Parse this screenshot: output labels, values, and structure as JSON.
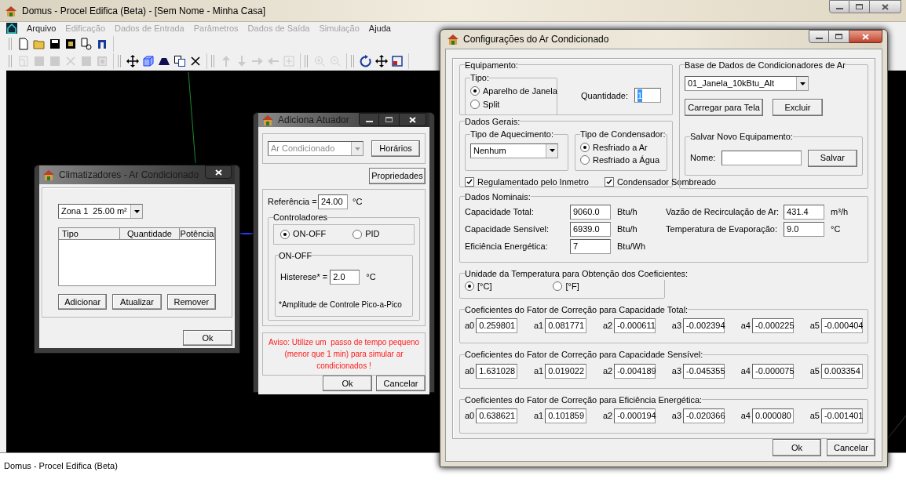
{
  "main_window": {
    "title": "Domus - Procel Edifica (Beta) - [Sem Nome - Minha Casa]",
    "menu": [
      {
        "label": "Arquivo",
        "disabled": false
      },
      {
        "label": "Edificação",
        "disabled": true
      },
      {
        "label": "Dados de Entrada",
        "disabled": true
      },
      {
        "label": "Parâmetros",
        "disabled": true
      },
      {
        "label": "Dados de Saída",
        "disabled": true
      },
      {
        "label": "Simulação",
        "disabled": true
      },
      {
        "label": "Ajuda",
        "disabled": false
      }
    ],
    "toolbars": [
      [
        [
          {
            "kind": "new",
            "disabled": false
          },
          {
            "kind": "open",
            "disabled": false
          },
          {
            "kind": "save",
            "disabled": false
          },
          {
            "kind": "chip",
            "disabled": false
          },
          {
            "kind": "script",
            "disabled": false
          },
          {
            "kind": "door",
            "disabled": false
          }
        ]
      ],
      [
        [
          {
            "kind": "page",
            "disabled": true
          },
          {
            "kind": "square",
            "disabled": true
          },
          {
            "kind": "square",
            "disabled": true
          },
          {
            "kind": "cross",
            "disabled": true
          },
          {
            "kind": "square",
            "disabled": true
          },
          {
            "kind": "frame",
            "disabled": true
          }
        ],
        [
          {
            "kind": "move",
            "disabled": false
          },
          {
            "kind": "cube",
            "disabled": false
          },
          {
            "kind": "shape",
            "disabled": false
          },
          {
            "kind": "copy",
            "disabled": false
          },
          {
            "kind": "cross",
            "disabled": false
          }
        ],
        [
          {
            "kind": "up",
            "disabled": true
          },
          {
            "kind": "down",
            "disabled": true
          },
          {
            "kind": "right",
            "disabled": true
          },
          {
            "kind": "left",
            "disabled": true
          },
          {
            "kind": "plus",
            "disabled": true
          }
        ],
        [
          {
            "kind": "zoomin",
            "disabled": true
          },
          {
            "kind": "zoomout",
            "disabled": true
          }
        ],
        [
          {
            "kind": "rotate",
            "disabled": false
          },
          {
            "kind": "move",
            "disabled": false
          },
          {
            "kind": "select",
            "disabled": false
          }
        ]
      ]
    ],
    "status_text": "Domus - Procel Edifica (Beta)"
  },
  "climatizadores": {
    "title": "Climatizadores - Ar Condicionado",
    "zone": "Zona 1  25.00 m²",
    "columns": [
      "Tipo",
      "Quantidade",
      "Potência"
    ],
    "buttons": [
      "Adicionar",
      "Atualizar",
      "Remover"
    ],
    "ok": "Ok"
  },
  "atuador": {
    "title": "Adiciona Atuador",
    "type_select": {
      "value": "Ar Condicionado",
      "disabled": true
    },
    "schedules_button": "Horários",
    "properties_button": "Propriedades",
    "reference_label": "Referência =",
    "reference_value": "24.00",
    "reference_unit": "°C",
    "controllers": {
      "title": "Controladores",
      "options": [
        {
          "label": "ON-OFF",
          "selected": true
        },
        {
          "label": "PID",
          "selected": false
        }
      ]
    },
    "onoff": {
      "title": "ON-OFF",
      "label": "Histerese* =",
      "value": "2.0",
      "unit": "°C",
      "note": "*Amplitude de Controle Pico-a-Pico"
    },
    "warning": "Aviso: Utilize um  passo de tempo pequeno (menor que 1 min) para simular ar condicionados !",
    "buttons": [
      "Ok",
      "Cancelar"
    ]
  },
  "config": {
    "title": "Configurações do Ar Condicionado",
    "equipamento": {
      "title": "Equipamento:",
      "tipo": {
        "title": "Tipo:",
        "options": [
          {
            "label": "Aparelho de Janela",
            "selected": true
          },
          {
            "label": "Split",
            "selected": false
          }
        ]
      },
      "quantidade_label": "Quantidade:",
      "quantidade_value": "1"
    },
    "dados_gerais": {
      "title": "Dados Gerais:",
      "aquecimento": {
        "title": "Tipo de Aquecimento:",
        "value": "Nenhum"
      },
      "condensador": {
        "title": "Tipo de Condensador:",
        "options": [
          {
            "label": "Resfriado a Ar",
            "selected": true
          },
          {
            "label": "Resfriado a Água",
            "selected": false
          }
        ]
      },
      "checks": [
        {
          "label": "Regulamentado pelo Inmetro",
          "checked": true
        },
        {
          "label": "Condensador Sombreado",
          "checked": true
        }
      ]
    },
    "base_dados": {
      "title": "Base de Dados de Condicionadores de Ar",
      "value": "01_Janela_10kBtu_Alt",
      "buttons": [
        "Carregar para Tela",
        "Excluir"
      ],
      "salvar": {
        "title": "Salvar Novo Equipamento:",
        "label": "Nome:",
        "button": "Salvar"
      }
    },
    "dados_nominais": {
      "title": "Dados Nominais:",
      "left": [
        {
          "label": "Capacidade Total:",
          "value": "9060.0",
          "unit": "Btu/h"
        },
        {
          "label": "Capacidade Sensível:",
          "value": "6939.0",
          "unit": "Btu/h"
        },
        {
          "label": "Eficiência Energética:",
          "value": "7",
          "unit": "Btu/Wh"
        }
      ],
      "right": [
        {
          "label": "Vazão de Recirculação de Ar:",
          "value": "431.4",
          "unit": "m³/h"
        },
        {
          "label": "Temperatura de Evaporação:",
          "value": "9.0",
          "unit": "°C"
        }
      ]
    },
    "unidade": {
      "title": "Unidade da Temperatura para Obtenção dos Coeficientes:",
      "options": [
        {
          "label": "[°C]",
          "selected": true
        },
        {
          "label": "[°F]",
          "selected": false
        }
      ]
    },
    "coeficientes": [
      {
        "title": "Coeficientes do Fator de Correção para Capacidade Total:",
        "values": [
          {
            "label": "a0",
            "value": "0.259801"
          },
          {
            "label": "a1",
            "value": "0.081771"
          },
          {
            "label": "a2",
            "value": "-0.000611"
          },
          {
            "label": "a3",
            "value": "-0.002394"
          },
          {
            "label": "a4",
            "value": "-0.000225"
          },
          {
            "label": "a5",
            "value": "-0.000404"
          }
        ]
      },
      {
        "title": "Coeficientes do Fator de Correção para Capacidade Sensível:",
        "values": [
          {
            "label": "a0",
            "value": "1.631028"
          },
          {
            "label": "a1",
            "value": "0.019022"
          },
          {
            "label": "a2",
            "value": "-0.004189"
          },
          {
            "label": "a3",
            "value": "-0.045355"
          },
          {
            "label": "a4",
            "value": "-0.000075"
          },
          {
            "label": "a5",
            "value": "0.003354"
          }
        ]
      },
      {
        "title": "Coeficientes do Fator de Correção para Eficiência Energética:",
        "values": [
          {
            "label": "a0",
            "value": "0.638621"
          },
          {
            "label": "a1",
            "value": "0.101859"
          },
          {
            "label": "a2",
            "value": "-0.000194"
          },
          {
            "label": "a3",
            "value": "-0.020366"
          },
          {
            "label": "a4",
            "value": "0.000080"
          },
          {
            "label": "a5",
            "value": "-0.001401"
          }
        ]
      }
    ],
    "buttons": [
      "Ok",
      "Cancelar"
    ]
  }
}
